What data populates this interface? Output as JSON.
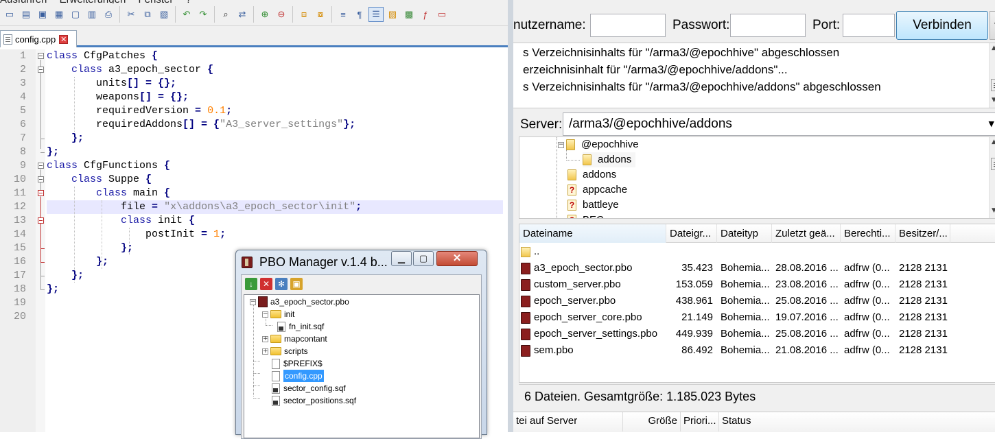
{
  "npp": {
    "menu": [
      "Ausführen",
      "Erweiterungen",
      "Fenster",
      "?"
    ],
    "tab": {
      "label": "config.cpp"
    },
    "lines": [
      {
        "n": "1"
      },
      {
        "n": "2"
      },
      {
        "n": "3"
      },
      {
        "n": "4"
      },
      {
        "n": "5"
      },
      {
        "n": "6"
      },
      {
        "n": "7"
      },
      {
        "n": "8"
      },
      {
        "n": "9"
      },
      {
        "n": "10"
      },
      {
        "n": "11"
      },
      {
        "n": "12"
      },
      {
        "n": "13"
      },
      {
        "n": "14"
      },
      {
        "n": "15"
      },
      {
        "n": "16"
      },
      {
        "n": "17"
      },
      {
        "n": "18"
      },
      {
        "n": "19"
      },
      {
        "n": "20"
      }
    ],
    "code": {
      "l1_kw": "class",
      "l1_rest": " CfgPatches ",
      "l1_op": "{",
      "l2_kw": "class",
      "l2_rest": " a3_epoch_sector ",
      "l2_op": "{",
      "l3_a": "units",
      "l3_op": "[] = {};",
      "l4_a": "weapons",
      "l4_op": "[] = {};",
      "l5_a": "requiredVersion ",
      "l5_op": "=",
      "l5_num": "0.1",
      "l5_end": ";",
      "l6_a": "requiredAddons",
      "l6_op": "[] = {",
      "l6_str": "\"A3_server_settings\"",
      "l6_end": "};",
      "l7": "};",
      "l8": "};",
      "l9_kw": "class",
      "l9_rest": " CfgFunctions ",
      "l9_op": "{",
      "l10_kw": "class",
      "l10_rest": " Suppe ",
      "l10_op": "{",
      "l11_kw": "class",
      "l11_rest": " main ",
      "l11_op": "{",
      "l12_a": "file ",
      "l12_op": "=",
      "l12_str": " \"x\\addons\\a3_epoch_sector\\init\"",
      "l12_end": ";",
      "l13_kw": "class",
      "l13_rest": " init ",
      "l13_op": "{",
      "l14_a": "postInit ",
      "l14_op": "=",
      "l14_num": " 1",
      "l14_end": ";",
      "l15": "};",
      "l16": "};",
      "l17": "};",
      "l18": "};"
    }
  },
  "pbo": {
    "title": "PBO Manager v.1.4 b...",
    "tree": {
      "root": "a3_epoch_sector.pbo",
      "init": "init",
      "fn_init": "fn_init.sqf",
      "mapcontant": "mapcontant",
      "scripts": "scripts",
      "prefix": "$PREFIX$",
      "config": "config.cpp",
      "sector_config": "sector_config.sqf",
      "sector_positions": "sector_positions.sqf"
    }
  },
  "fz": {
    "quick": {
      "user_label": "nutzername:",
      "pass_label": "Passwort:",
      "port_label": "Port:",
      "connect": "Verbinden"
    },
    "log": [
      "s Verzeichnisinhalts für \"/arma3/@epochhive\" abgeschlossen",
      "erzeichnisinhalt für \"/arma3/@epochhive/addons\"...",
      "s Verzeichnisinhalts für \"/arma3/@epochhive/addons\" abgeschlossen"
    ],
    "server_label": "Server:",
    "server_path": "/arma3/@epochhive/addons",
    "tree": {
      "epochhive": "@epochhive",
      "addons_sel": "addons",
      "addons": "addons",
      "appcache": "appcache",
      "battleye": "battleye",
      "bec": "BEC"
    },
    "headers": [
      "Dateiname",
      "Dateigr...",
      "Dateityp",
      "Zuletzt geä...",
      "Berechti...",
      "Besitzer/..."
    ],
    "files": [
      {
        "name": "..",
        "size": "",
        "type": "",
        "date": "",
        "perm": "",
        "owner": ""
      },
      {
        "name": "a3_epoch_sector.pbo",
        "size": "35.423",
        "type": "Bohemia...",
        "date": "28.08.2016 ...",
        "perm": "adfrw (0...",
        "owner": "2128 2131"
      },
      {
        "name": "custom_server.pbo",
        "size": "153.059",
        "type": "Bohemia...",
        "date": "23.08.2016 ...",
        "perm": "adfrw (0...",
        "owner": "2128 2131"
      },
      {
        "name": "epoch_server.pbo",
        "size": "438.961",
        "type": "Bohemia...",
        "date": "25.08.2016 ...",
        "perm": "adfrw (0...",
        "owner": "2128 2131"
      },
      {
        "name": "epoch_server_core.pbo",
        "size": "21.149",
        "type": "Bohemia...",
        "date": "19.07.2016 ...",
        "perm": "adfrw (0...",
        "owner": "2128 2131"
      },
      {
        "name": "epoch_server_settings.pbo",
        "size": "449.939",
        "type": "Bohemia...",
        "date": "25.08.2016 ...",
        "perm": "adfrw (0...",
        "owner": "2128 2131"
      },
      {
        "name": "sem.pbo",
        "size": "86.492",
        "type": "Bohemia...",
        "date": "21.08.2016 ...",
        "perm": "adfrw (0...",
        "owner": "2128 2131"
      }
    ],
    "status": "6 Dateien. Gesamtgröße: 1.185.023 Bytes",
    "queue_headers": [
      "tei auf Server",
      "Größe",
      "Priori...",
      "Status"
    ]
  }
}
